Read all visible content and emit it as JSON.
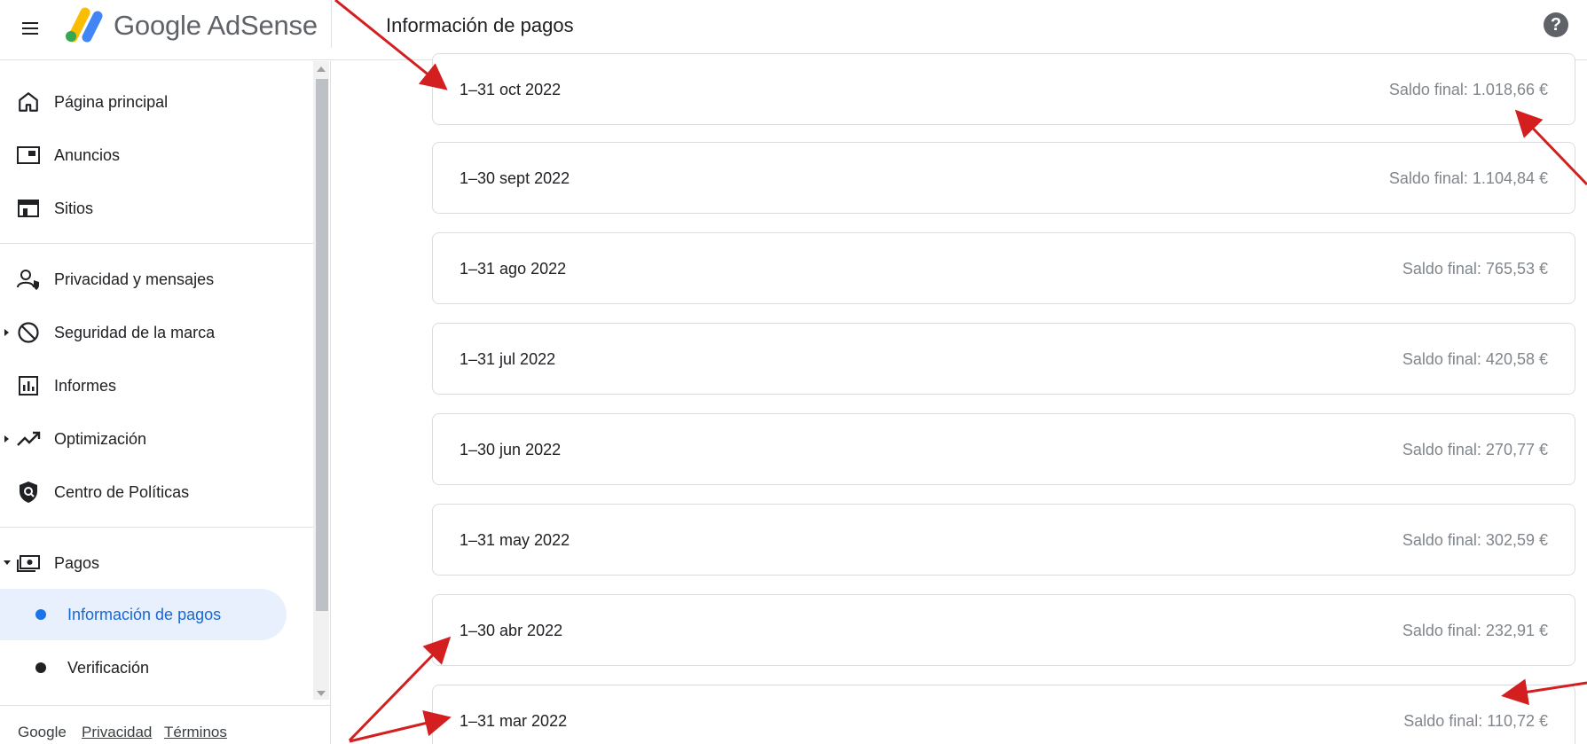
{
  "header": {
    "brand": "Google AdSense",
    "page_title": "Información de pagos",
    "help_label": "?"
  },
  "sidebar": {
    "items": [
      {
        "label": "Página principal",
        "icon": "home-icon"
      },
      {
        "label": "Anuncios",
        "icon": "ads-icon"
      },
      {
        "label": "Sitios",
        "icon": "sites-icon"
      },
      {
        "label": "Privacidad y mensajes",
        "icon": "privacy-icon"
      },
      {
        "label": "Seguridad de la marca",
        "icon": "block-icon"
      },
      {
        "label": "Informes",
        "icon": "reports-icon"
      },
      {
        "label": "Optimización",
        "icon": "trending-up-icon"
      },
      {
        "label": "Centro de Políticas",
        "icon": "policy-shield-icon"
      },
      {
        "label": "Pagos",
        "icon": "payments-icon"
      }
    ],
    "sub_items": [
      {
        "label": "Información de pagos",
        "active": true
      },
      {
        "label": "Verificación",
        "active": false
      }
    ]
  },
  "footer": {
    "brand": "Google",
    "privacy": "Privacidad",
    "terms": "Términos"
  },
  "statements": [
    {
      "period": "1–31 oct 2022",
      "balance": "Saldo final: 1.018,66 €"
    },
    {
      "period": "1–30 sept 2022",
      "balance": "Saldo final: 1.104,84 €"
    },
    {
      "period": "1–31 ago 2022",
      "balance": "Saldo final: 765,53 €"
    },
    {
      "period": "1–31 jul 2022",
      "balance": "Saldo final: 420,58 €"
    },
    {
      "period": "1–30 jun 2022",
      "balance": "Saldo final: 270,77 €"
    },
    {
      "period": "1–31 may 2022",
      "balance": "Saldo final: 302,59 €"
    },
    {
      "period": "1–30 abr 2022",
      "balance": "Saldo final: 232,91 €"
    },
    {
      "period": "1–31 mar 2022",
      "balance": "Saldo final: 110,72 €"
    }
  ],
  "colors": {
    "accent": "#1a73e8",
    "active_bg": "#e8f0fe",
    "annotation": "#d31f1f"
  }
}
